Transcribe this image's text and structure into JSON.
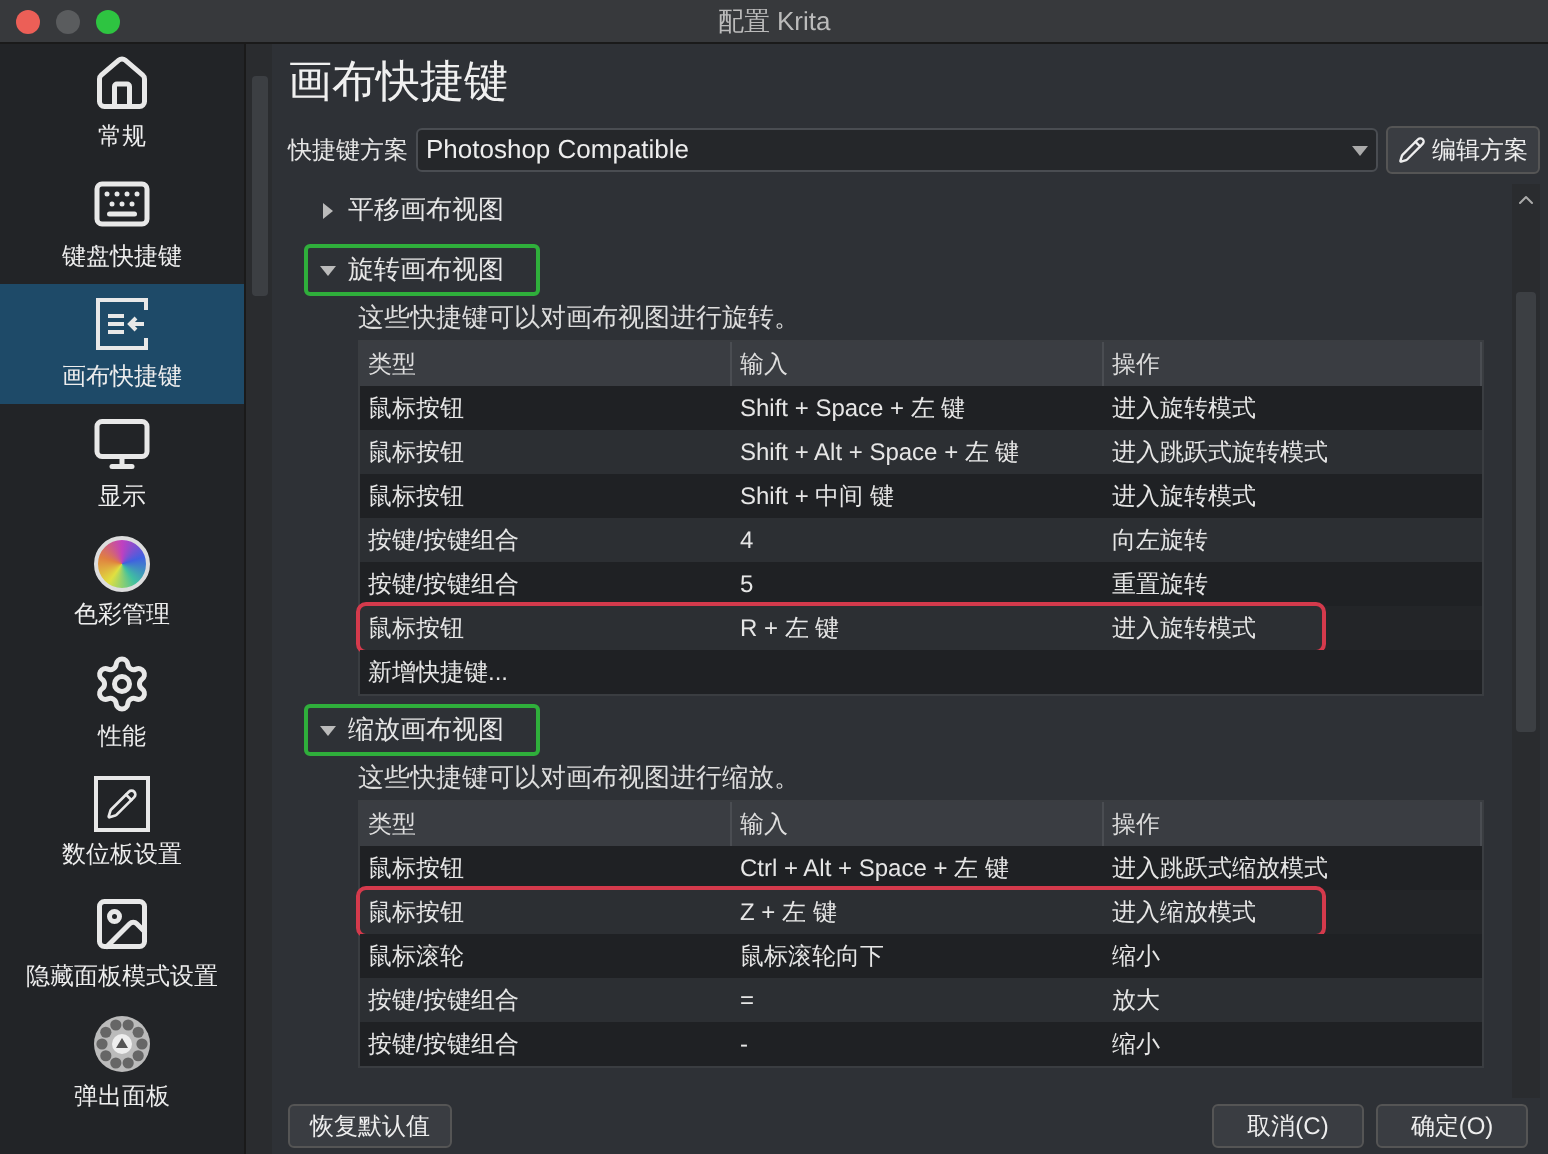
{
  "window": {
    "title": "配置 Krita"
  },
  "sidebar": {
    "items": [
      {
        "label": "常规",
        "selected": false
      },
      {
        "label": "键盘快捷键",
        "selected": false
      },
      {
        "label": "画布快捷键",
        "selected": true
      },
      {
        "label": "显示",
        "selected": false
      },
      {
        "label": "色彩管理",
        "selected": false
      },
      {
        "label": "性能",
        "selected": false
      },
      {
        "label": "数位板设置",
        "selected": false
      },
      {
        "label": "隐藏面板模式设置",
        "selected": false
      },
      {
        "label": "弹出面板",
        "selected": false
      }
    ]
  },
  "page_title": "画布快捷键",
  "scheme": {
    "label": "快捷键方案",
    "value": "Photoshop Compatible",
    "edit_button": "编辑方案"
  },
  "sections": [
    {
      "title": "平移画布视图",
      "expanded": false,
      "annotated": false
    },
    {
      "title": "旋转画布视图",
      "expanded": true,
      "annotated": true,
      "description": "这些快捷键可以对画布视图进行旋转。",
      "columns": [
        "类型",
        "输入",
        "操作"
      ],
      "rows": [
        {
          "cells": [
            "鼠标按钮",
            "Shift + Space + 左 键",
            "进入旋转模式"
          ],
          "annotated": false
        },
        {
          "cells": [
            "鼠标按钮",
            "Shift + Alt + Space + 左 键",
            "进入跳跃式旋转模式"
          ],
          "annotated": false
        },
        {
          "cells": [
            "鼠标按钮",
            "Shift + 中间 键",
            "进入旋转模式"
          ],
          "annotated": false
        },
        {
          "cells": [
            "按键/按键组合",
            "4",
            "向左旋转"
          ],
          "annotated": false
        },
        {
          "cells": [
            "按键/按键组合",
            "5",
            "重置旋转"
          ],
          "annotated": false
        },
        {
          "cells": [
            "鼠标按钮",
            "R + 左 键",
            "进入旋转模式"
          ],
          "annotated": true
        }
      ],
      "add_row": "新增快捷键..."
    },
    {
      "title": "缩放画布视图",
      "expanded": true,
      "annotated": true,
      "description": "这些快捷键可以对画布视图进行缩放。",
      "columns": [
        "类型",
        "输入",
        "操作"
      ],
      "rows": [
        {
          "cells": [
            "鼠标按钮",
            "Ctrl + Alt + Space + 左 键",
            "进入跳跃式缩放模式"
          ],
          "annotated": false
        },
        {
          "cells": [
            "鼠标按钮",
            "Z + 左 键",
            "进入缩放模式"
          ],
          "annotated": true
        },
        {
          "cells": [
            "鼠标滚轮",
            "鼠标滚轮向下",
            "缩小"
          ],
          "annotated": false
        },
        {
          "cells": [
            "按键/按键组合",
            "=",
            "放大"
          ],
          "annotated": false
        },
        {
          "cells": [
            "按键/按键组合",
            "-",
            "缩小"
          ],
          "annotated": false
        }
      ]
    }
  ],
  "buttons": {
    "restore": "恢复默认值",
    "cancel": "取消(C)",
    "ok": "确定(O)"
  }
}
